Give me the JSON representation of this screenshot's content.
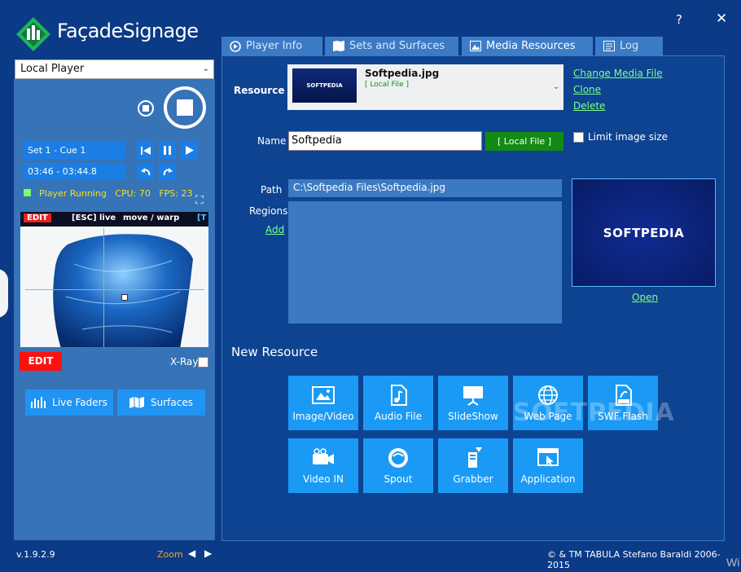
{
  "app": {
    "logo_text": "FaçadeSignage",
    "help": "?",
    "close": "✕",
    "version": "v.1.9.2.9",
    "zoom_label": "Zoom",
    "copyright": "© & TM TABULA Stefano Baraldi 2006-2015",
    "corner_text": "Wi"
  },
  "player": {
    "selected": "Local Player",
    "cue": "Set 1 - Cue 1",
    "time": "03:46 - 03:44.8",
    "status": "Player Running   CPU: 70   FPS: 23",
    "preview": {
      "edit_chip": "EDIT",
      "esc_hint": "[ESC] live",
      "move_hint": "move / warp",
      "trunc_hint": "[T"
    },
    "edit_button": "EDIT",
    "xray_label": "X-Ray",
    "live_faders": "Live Faders",
    "surfaces": "Surfaces"
  },
  "tabs": [
    {
      "label": "Player Info"
    },
    {
      "label": "Sets and Surfaces"
    },
    {
      "label": "Media Resources"
    },
    {
      "label": "Log"
    }
  ],
  "media": {
    "resource_label": "Resource",
    "resource_name": "Softpedia.jpg",
    "resource_type": "[ Local File ]",
    "thumb_text": "SOFTPEDIA",
    "change_link": "Change Media File",
    "clone_link": "Clone",
    "delete_link": "Delete",
    "name_label": "Name",
    "name_value": "Softpedia",
    "local_file_btn": "[ Local File ]",
    "limit_label": "Limit image size",
    "path_label": "Path",
    "path_value": "C:\\Softpedia Files\\Softpedia.jpg",
    "regions_label": "Regions",
    "add_link": "Add",
    "preview_text": "SOFTPEDIA",
    "open_link": "Open",
    "new_resource_title": "New Resource",
    "tiles": [
      {
        "label": "Image/Video",
        "icon": "image-icon"
      },
      {
        "label": "Audio File",
        "icon": "audio-file-icon"
      },
      {
        "label": "SlideShow",
        "icon": "slideshow-icon"
      },
      {
        "label": "Web Page",
        "icon": "globe-icon"
      },
      {
        "label": "SWF Flash",
        "icon": "swf-file-icon"
      },
      {
        "label": "Video IN",
        "icon": "video-camera-icon"
      },
      {
        "label": "Spout",
        "icon": "spout-icon"
      },
      {
        "label": "Grabber",
        "icon": "grabber-icon"
      },
      {
        "label": "Application",
        "icon": "application-window-icon"
      }
    ],
    "watermark": "SOFTPEDIA"
  }
}
